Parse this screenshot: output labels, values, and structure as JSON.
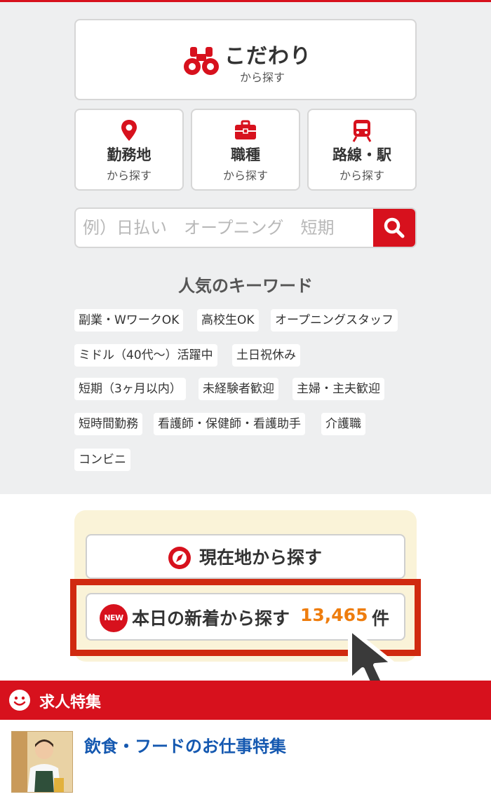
{
  "kodawari": {
    "title": "こだわり",
    "sub": "から探す"
  },
  "categories": [
    {
      "title": "勤務地",
      "sub": "から探す",
      "icon": "map-pin-icon"
    },
    {
      "title": "職種",
      "sub": "から探す",
      "icon": "briefcase-icon"
    },
    {
      "title": "路線・駅",
      "sub": "から探す",
      "icon": "train-icon"
    }
  ],
  "search": {
    "placeholder": "例）日払い　オープニング　短期"
  },
  "keywords": {
    "title": "人気のキーワード",
    "items": [
      "副業・WワークOK",
      "高校生OK",
      "オープニングスタッフ",
      "ミドル（40代〜）活躍中",
      "土日祝休み",
      "短期（3ヶ月以内）",
      "未経験者歓迎",
      "主婦・主夫歓迎",
      "短時間勤務",
      "看護師・保健師・看護助手",
      "介護職",
      "コンビニ"
    ]
  },
  "location_button": {
    "label": "現在地から探す"
  },
  "new_button": {
    "badge": "NEW",
    "label": "本日の新着から探す",
    "count": "13,465",
    "unit": "件"
  },
  "feature": {
    "header": "求人特集",
    "item_title": "飲食・フードのお仕事特集"
  },
  "colors": {
    "brand_red": "#d7111d",
    "accent_orange": "#ee7d0e",
    "link_blue": "#1458b0",
    "highlight_red": "#d02a10"
  }
}
